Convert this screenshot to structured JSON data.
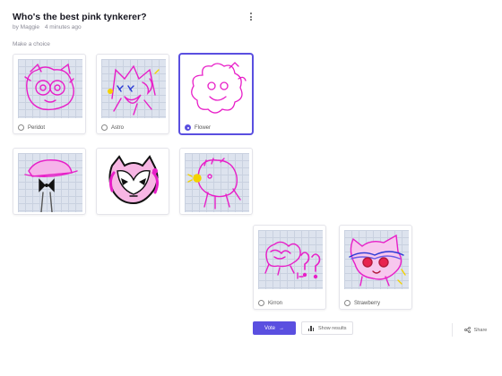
{
  "poll": {
    "title": "Who's the best pink tynkerer?",
    "author": "by Maggie",
    "time": "4 minutes ago",
    "prompt": "Make a choice"
  },
  "options": [
    {
      "label": "Peridot",
      "selected": false
    },
    {
      "label": "Astro",
      "selected": false
    },
    {
      "label": "Flower",
      "selected": true
    },
    {
      "label": "",
      "selected": false
    },
    {
      "label": "",
      "selected": false
    },
    {
      "label": "",
      "selected": false
    },
    {
      "label": "Kirron",
      "selected": false
    },
    {
      "label": "Strawberry",
      "selected": false
    }
  ],
  "actions": {
    "vote": "Vote",
    "results": "Show results",
    "share": "Share"
  },
  "colors": {
    "accent": "#5a4fe0",
    "drawing_pink": "#e81fc8"
  },
  "icons": {
    "menu": "kebab-menu-icon",
    "vote_arrow": "arrow-right-icon",
    "results": "bar-chart-icon",
    "share": "share-icon"
  }
}
